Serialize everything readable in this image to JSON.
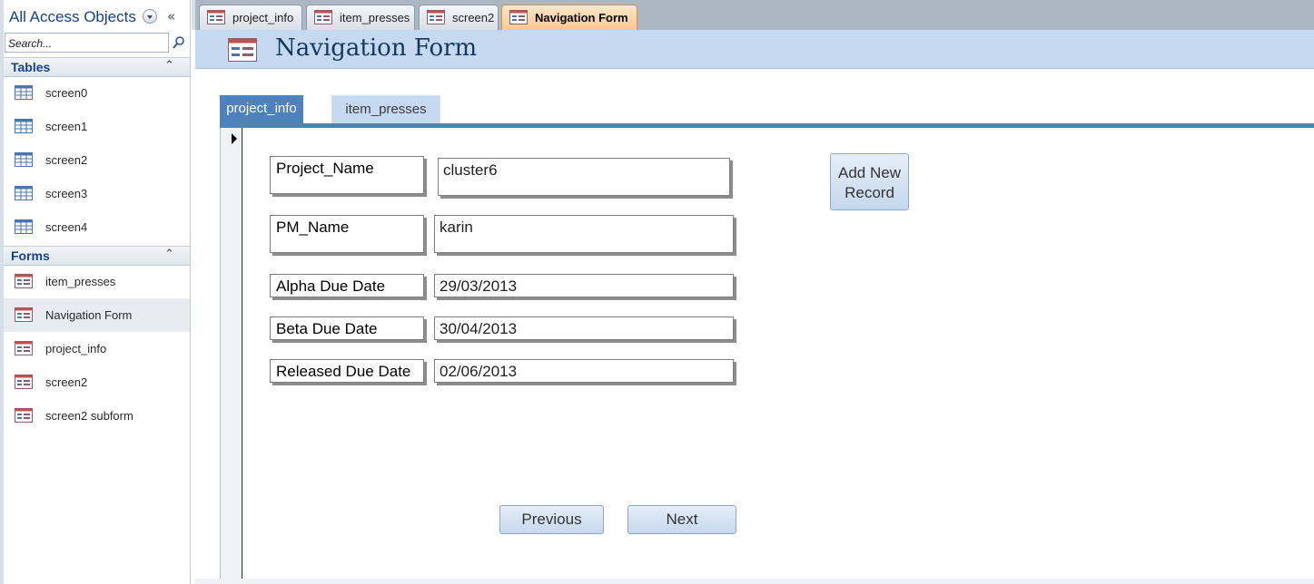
{
  "nav_pane": {
    "title": "All Access Objects",
    "collapse_glyph": "«",
    "search": {
      "placeholder": "Search..."
    },
    "groups": [
      {
        "label": "Tables",
        "chevron": "⌃",
        "items": [
          {
            "label": "screen0",
            "icon": "table-icon"
          },
          {
            "label": "screen1",
            "icon": "table-icon"
          },
          {
            "label": "screen2",
            "icon": "table-icon"
          },
          {
            "label": "screen3",
            "icon": "table-icon"
          },
          {
            "label": "screen4",
            "icon": "table-icon"
          }
        ]
      },
      {
        "label": "Forms",
        "chevron": "⌃",
        "items": [
          {
            "label": "item_presses",
            "icon": "form-icon"
          },
          {
            "label": "Navigation Form",
            "icon": "form-icon",
            "selected": true
          },
          {
            "label": "project_info",
            "icon": "form-icon"
          },
          {
            "label": "screen2",
            "icon": "form-icon"
          },
          {
            "label": "screen2 subform",
            "icon": "form-icon"
          }
        ]
      }
    ]
  },
  "doc_tabs": [
    {
      "label": "project_info",
      "icon": "form-icon",
      "active": false
    },
    {
      "label": "item_presses",
      "icon": "form-icon",
      "active": false
    },
    {
      "label": "screen2",
      "icon": "form-icon",
      "active": false
    },
    {
      "label": "Navigation Form",
      "icon": "form-icon",
      "active": true
    }
  ],
  "form": {
    "title": "Navigation Form",
    "nav_tabs": [
      {
        "label": "project_info",
        "active": true
      },
      {
        "label": "item_presses",
        "active": false
      }
    ],
    "fields": [
      {
        "label": "Project_Name",
        "value": "cluster6"
      },
      {
        "label": "PM_Name",
        "value": "karin"
      },
      {
        "label": "Alpha Due Date",
        "value": "29/03/2013"
      },
      {
        "label": "Beta Due Date",
        "value": "30/04/2013"
      },
      {
        "label": "Released Due Date",
        "value": "02/06/2013"
      }
    ],
    "buttons": {
      "add_new_line1": "Add New",
      "add_new_line2": "Record",
      "previous": "Previous",
      "next": "Next"
    }
  },
  "colors": {
    "header_bg": "#c5d9f1",
    "tab_active": "#4f81bd",
    "title_text": "#17375e",
    "nav_heading": "#15428b"
  }
}
